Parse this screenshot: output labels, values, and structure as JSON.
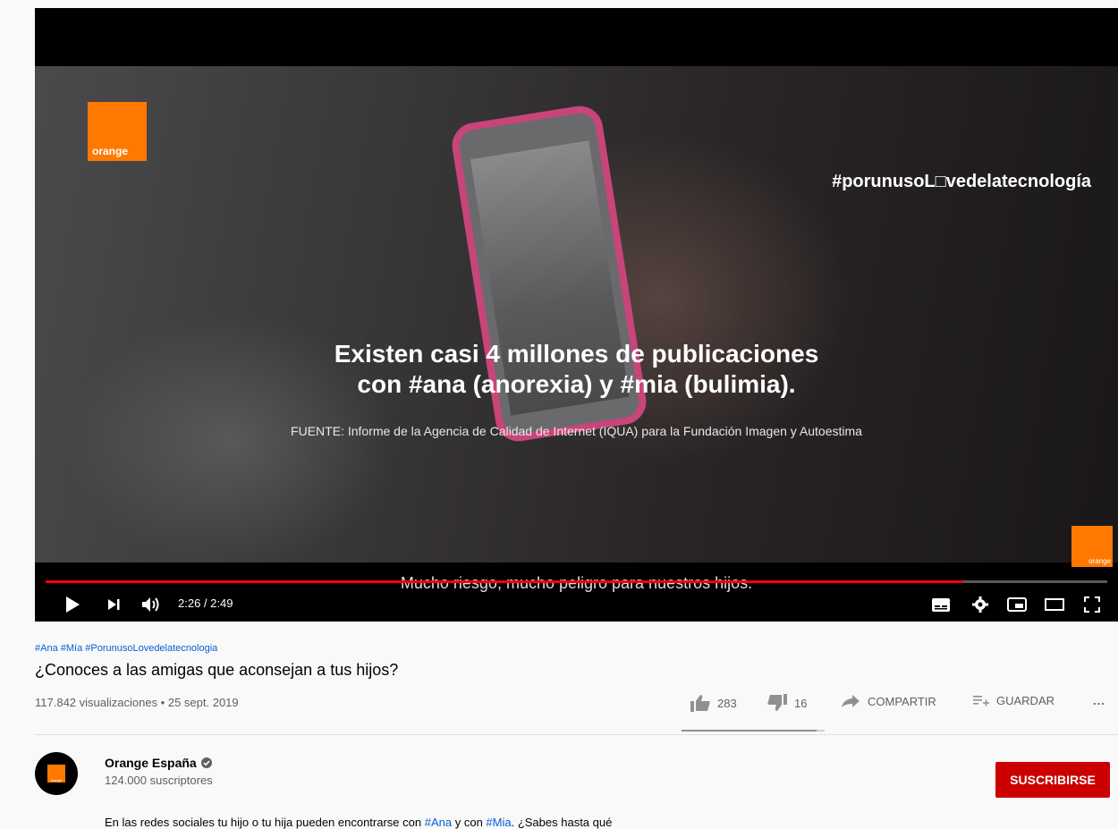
{
  "player": {
    "hashtag_overlay": "#porunusoL□vedelatecnología",
    "orange_logo_text": "orange",
    "headline_line1": "Existen casi 4 millones de publicaciones",
    "headline_line2": "con #ana (anorexia) y #mia (bulimia).",
    "source": "FUENTE: Informe de la Agencia de Calidad de Internet (IQUA) para la Fundación Imagen y Autoestima",
    "subtitle": "Mucho riesgo, mucho peligro para nuestros hijos.",
    "time": "2:26 / 2:49",
    "progress_percent": 86.4
  },
  "video": {
    "tags": "#Ana #Mía #PorunusoLovedelatecnologia",
    "title": "¿Conoces a las amigas que aconsejan a tus hijos?",
    "views_date": "117.842 visualizaciones • 25 sept. 2019",
    "likes": "283",
    "dislikes": "16",
    "share_label": "COMPARTIR",
    "save_label": "GUARDAR",
    "more_label": "...",
    "like_ratio_percent": 94.6
  },
  "channel": {
    "name": "Orange España",
    "subscribers": "124.000 suscriptores",
    "subscribe_label": "SUSCRIBIRSE",
    "avatar_text": "orange"
  },
  "description": {
    "part1": "En las redes sociales tu hijo o tu hija pueden encontrarse con ",
    "link1": "#Ana",
    "part2": " y con ",
    "link2": "#Mia",
    "part3": ". ¿Sabes hasta qué"
  },
  "colors": {
    "brand_orange": "#ff7900",
    "progress_red": "#ff0000",
    "subscribe_red": "#cc0000",
    "link_blue": "#065fd4"
  }
}
